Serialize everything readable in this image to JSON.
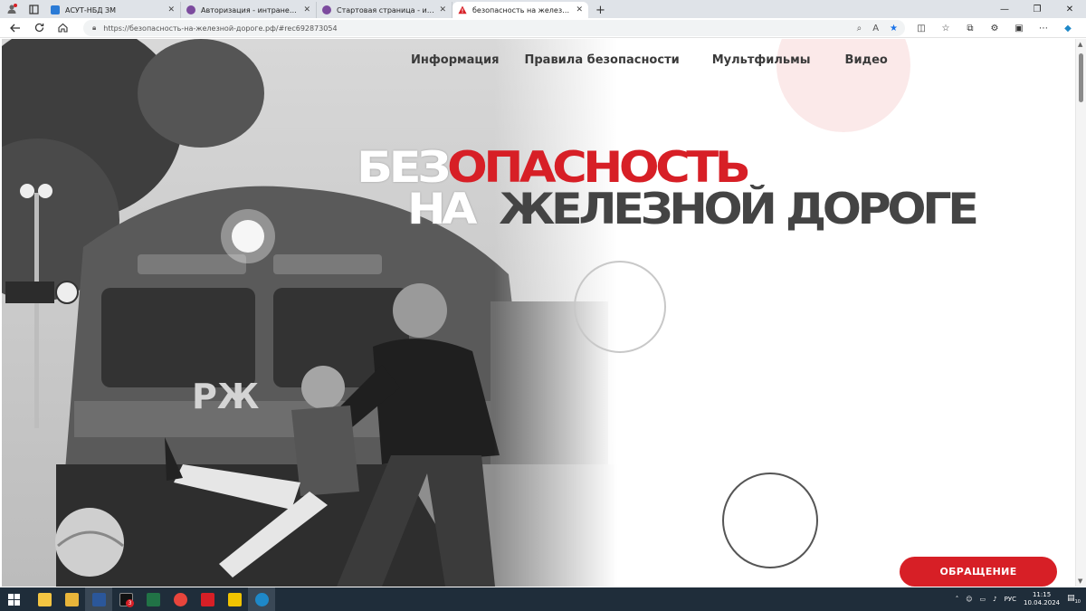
{
  "browser": {
    "tabs": [
      {
        "label": "АСУТ-НБД ЗМ",
        "color": "#2b7bd6"
      },
      {
        "label": "Авторизация - интранет версия",
        "color": "#7c4b9e"
      },
      {
        "label": "Стартовая страница - интранет",
        "color": "#7c4b9e"
      },
      {
        "label": "безопасность на железной дороге",
        "color": "#d71f26"
      }
    ],
    "new_tab": "+",
    "url": "https://безопасность-на-железной-дороге.рф/#rec692873054"
  },
  "site": {
    "menu": [
      {
        "label": "Информация"
      },
      {
        "label": "Правила безопасности"
      },
      {
        "label": "Мультфильмы"
      },
      {
        "label": "Видео"
      }
    ],
    "title_line1_white": "БЕЗ",
    "title_line1_red": "ОПАСНОСТЬ",
    "title_line2_white": "НА",
    "title_line2_dark": "ЖЕЛЕЗНОЙ ДОРОГЕ",
    "cta_label": "ОБРАЩЕНИЕ",
    "accent_color": "#d71f26"
  },
  "taskbar": {
    "apps": [
      {
        "name": "file-explorer",
        "color": "#f4c542"
      },
      {
        "name": "folder",
        "color": "#e8b53a"
      },
      {
        "name": "word",
        "color": "#2b579a"
      },
      {
        "name": "app-3",
        "color": "#111111",
        "badge": "3"
      },
      {
        "name": "excel",
        "color": "#217346"
      },
      {
        "name": "chrome",
        "color": "#e8453c"
      },
      {
        "name": "acrobat",
        "color": "#d71f26"
      },
      {
        "name": "app-yellow",
        "color": "#f0c300"
      },
      {
        "name": "edge",
        "color": "#1e88c8"
      }
    ],
    "lang": "РУС",
    "time": "11:15",
    "date": "10.04.2024",
    "notif_count": "10"
  }
}
